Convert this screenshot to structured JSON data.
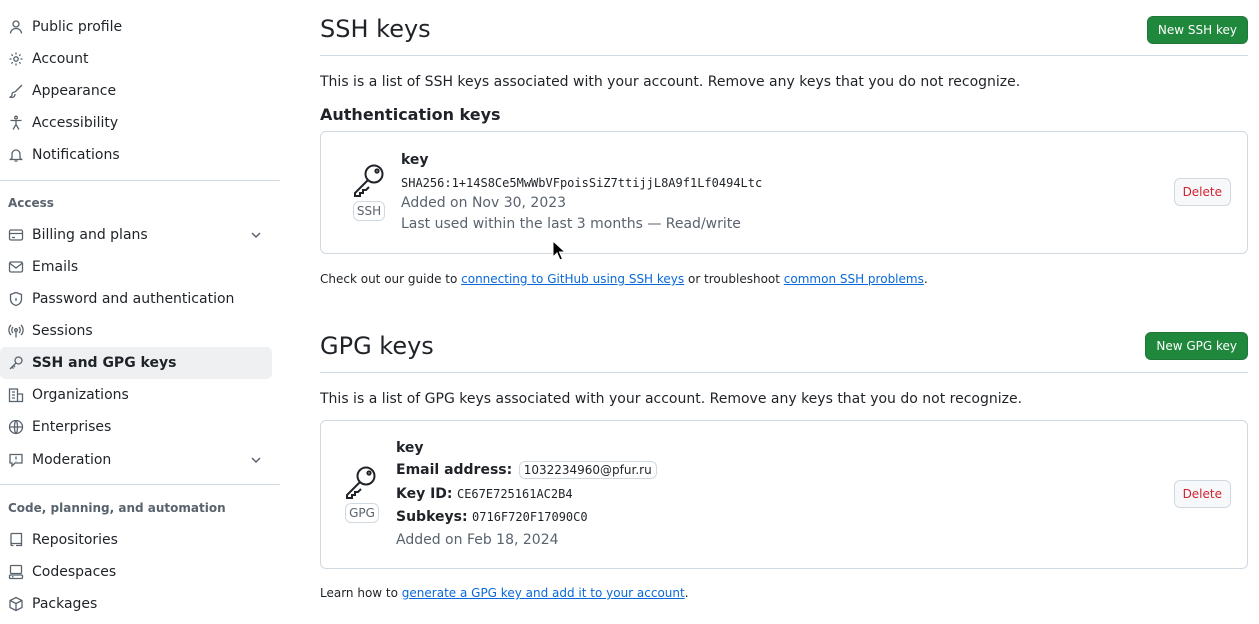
{
  "sidebar": {
    "items_top": [
      {
        "label": "Public profile",
        "icon": "person-icon"
      },
      {
        "label": "Account",
        "icon": "gear-icon"
      },
      {
        "label": "Appearance",
        "icon": "paintbrush-icon"
      },
      {
        "label": "Accessibility",
        "icon": "accessibility-icon"
      },
      {
        "label": "Notifications",
        "icon": "bell-icon"
      }
    ],
    "access_heading": "Access",
    "items_access": [
      {
        "label": "Billing and plans",
        "icon": "credit-card-icon",
        "expandable": true
      },
      {
        "label": "Emails",
        "icon": "mail-icon"
      },
      {
        "label": "Password and authentication",
        "icon": "shield-lock-icon"
      },
      {
        "label": "Sessions",
        "icon": "broadcast-icon"
      },
      {
        "label": "SSH and GPG keys",
        "icon": "key-icon",
        "active": true
      },
      {
        "label": "Organizations",
        "icon": "organization-icon"
      },
      {
        "label": "Enterprises",
        "icon": "globe-icon"
      },
      {
        "label": "Moderation",
        "icon": "report-icon",
        "expandable": true
      }
    ],
    "code_heading": "Code, planning, and automation",
    "items_code": [
      {
        "label": "Repositories",
        "icon": "repo-icon"
      },
      {
        "label": "Codespaces",
        "icon": "codespaces-icon"
      },
      {
        "label": "Packages",
        "icon": "package-icon"
      }
    ]
  },
  "ssh": {
    "title": "SSH keys",
    "new_button": "New SSH key",
    "description": "This is a list of SSH keys associated with your account. Remove any keys that you do not recognize.",
    "auth_heading": "Authentication keys",
    "key": {
      "badge": "SSH",
      "title": "key",
      "fingerprint": "SHA256:1+14S8Ce5MwWbVFpoisSiZ7ttijjL8A9f1Lf0494Ltc",
      "added": "Added on Nov 30, 2023",
      "last_used": "Last used within the last 3 months — Read/write",
      "delete": "Delete"
    },
    "help_prefix": "Check out our guide to ",
    "help_link1": "connecting to GitHub using SSH keys",
    "help_middle": " or troubleshoot ",
    "help_link2": "common SSH problems",
    "help_suffix": "."
  },
  "gpg": {
    "title": "GPG keys",
    "new_button": "New GPG key",
    "description": "This is a list of GPG keys associated with your account. Remove any keys that you do not recognize.",
    "key": {
      "badge": "GPG",
      "title": "key",
      "email_label": "Email address:",
      "email": "1032234960@pfur.ru",
      "keyid_label": "Key ID:",
      "keyid": "CE67E725161AC2B4",
      "subkeys_label": "Subkeys:",
      "subkeys": "0716F720F17090C0",
      "added": "Added on Feb 18, 2024",
      "delete": "Delete"
    },
    "help_prefix": "Learn how to ",
    "help_link": "generate a GPG key and add it to your account",
    "help_suffix": "."
  },
  "colors": {
    "primary_green": "#1f883d",
    "link_blue": "#0969da",
    "danger_red": "#d1242f",
    "muted": "#59636e",
    "border": "#d1d9e0"
  }
}
